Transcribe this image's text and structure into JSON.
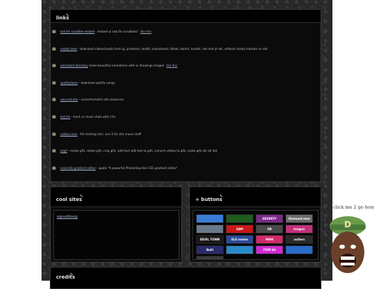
{
  "links_panel": {
    "title": "links",
    "rows": [
      {
        "link": "last.fm scrobble embed",
        "desc": " - embed ur last.fm scrobbles!",
        "like": "like this"
      },
      {
        "link": "cobalt.tools",
        "desc": " - download videos/audio from ig, pinterest, reddit, soundcloud, tiktok, twitch, tumblr, rwt and yt etc. without shady trackers or ads",
        "like": ""
      },
      {
        "link": "animated directory",
        "desc": " make beautiful animations with ur drawings images",
        "like": "like this"
      },
      {
        "link": "spotifydown",
        "desc": " - download spotify songs",
        "like": ""
      },
      {
        "link": "rwo.cod.site",
        "desc": " - cursor/tomelist site resources",
        "like": ""
      },
      {
        "link": "last.fm",
        "desc": " - track ur music stats with l.fm",
        "like": ""
      },
      {
        "link": "catbox.moe",
        "desc": " - file hosting site i use it for site music stuff",
        "like": ""
      },
      {
        "link": "ezgif",
        "desc": " - resize gifs, rotate gifs, crop gifs, add text add text to gifs, convert videos to gifs, make gifs etc all dat",
        "like": ""
      },
      {
        "link": "colorzilla gradient editor",
        "desc": " - quote \"A powerful Photoshop-like CSS gradient editor\"",
        "like": ""
      }
    ]
  },
  "cool_sites_panel": {
    "title": "cool sites",
    "link": "sqeedlinep"
  },
  "buttons_panel": {
    "title": "+ buttons",
    "buttons": [
      {
        "label": "",
        "color": "#3b7bd6"
      },
      {
        "label": "",
        "color": "#1e5b1e"
      },
      {
        "label": "SEVENTY",
        "color": "#7b2a8b"
      },
      {
        "label": "Diamond men",
        "color": "#6b6b6b"
      },
      {
        "label": "",
        "color": "#6b7a8a"
      },
      {
        "label": "SAM",
        "color": "#c81818"
      },
      {
        "label": "OB",
        "color": "#4a4a4a"
      },
      {
        "label": "tongue",
        "color": "#c4307a"
      },
      {
        "label": "DEVIL TOWN",
        "color": "#1a1a1a"
      },
      {
        "label": "ELO anime",
        "color": "#2a4a9a"
      },
      {
        "label": "9999",
        "color": "#d02a6a"
      },
      {
        "label": "authen",
        "color": "#2a2a2a"
      },
      {
        "label": "Bulli",
        "color": "#2a2a6a"
      },
      {
        "label": "",
        "color": "#2a8ac8"
      },
      {
        "label": "ITEM 64",
        "color": "#d02ad0"
      },
      {
        "label": "",
        "color": "#2a6ac8"
      },
      {
        "label": "",
        "color": "#3a3a3a"
      }
    ]
  },
  "credits_panel": {
    "title": "credits"
  },
  "home": {
    "label": "click me 2 go home",
    "arrow": "↓"
  }
}
